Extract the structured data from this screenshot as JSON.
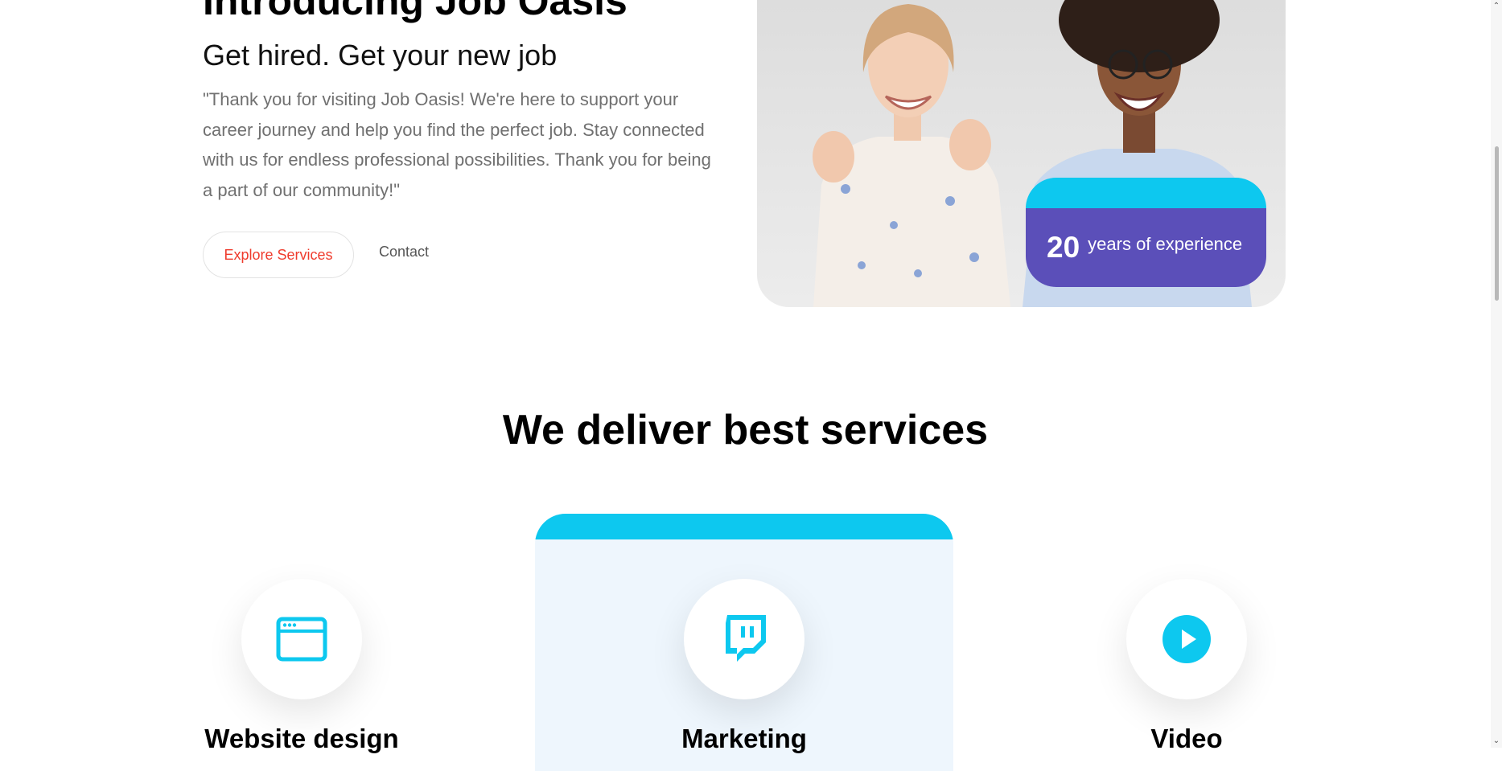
{
  "hero": {
    "title": "Introducing Job Oasis",
    "subtitle": "Get hired. Get your new job",
    "text": "\"Thank you for visiting Job Oasis! We're here to support your career journey and help you find the perfect job. Stay connected with us for endless professional possibilities. Thank you for being a part of our community!\"",
    "explore_label": "Explore Services",
    "contact_label": "Contact"
  },
  "experience": {
    "number": "20",
    "label": "years of experience"
  },
  "services": {
    "title": "We deliver best services",
    "items": [
      {
        "label": "Website design",
        "icon": "browser-window-icon"
      },
      {
        "label": "Marketing",
        "icon": "twitch-icon"
      },
      {
        "label": "Video",
        "icon": "play-circle-icon"
      }
    ]
  },
  "colors": {
    "accent": "#0dc8ef",
    "purple": "#5b4fb9",
    "explore_text": "#ef3b2d",
    "card_bg": "#eef6fd"
  }
}
